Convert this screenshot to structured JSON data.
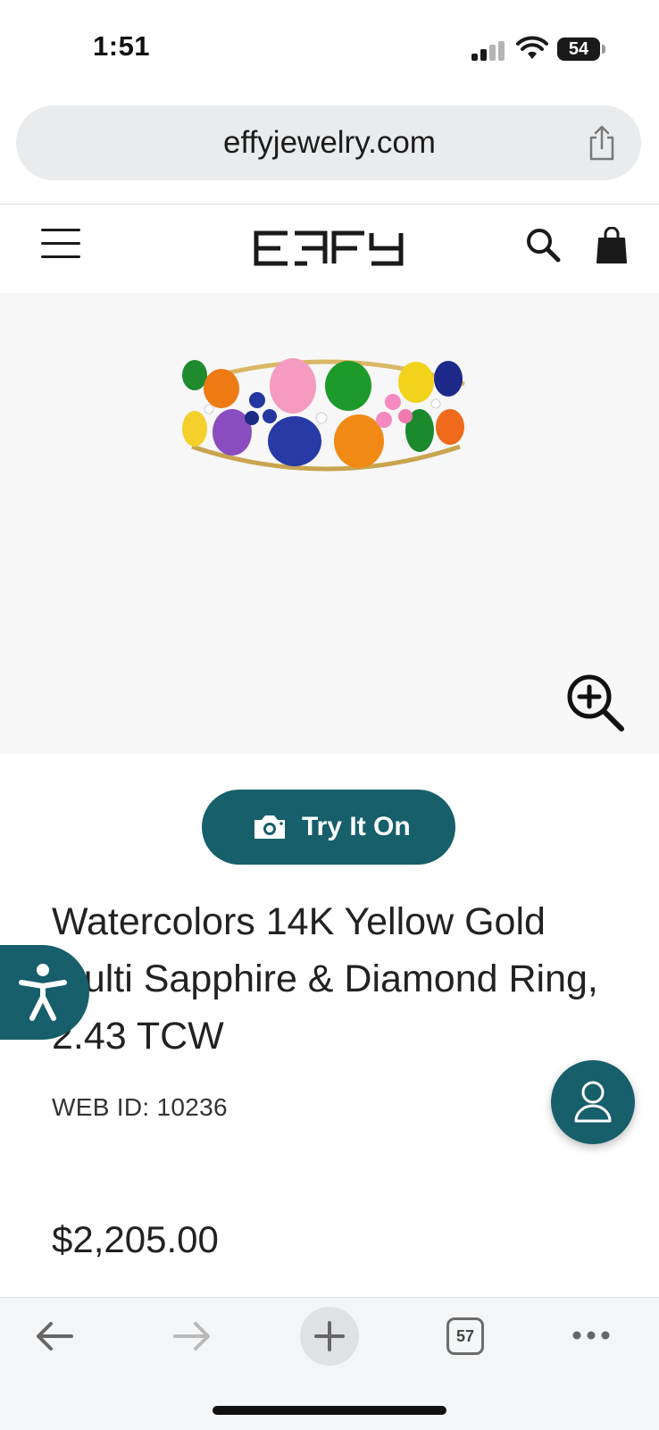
{
  "status_bar": {
    "time": "1:51",
    "battery": "54"
  },
  "browser": {
    "url": "effyjewelry.com",
    "tab_count": "57"
  },
  "header": {
    "logo_text": "EFFY"
  },
  "product": {
    "try_on_label": "Try It On",
    "title": "Watercolors 14K Yellow Gold Multi Sapphire & Diamond Ring, 2.43 TCW",
    "web_id_label": "WEB ID:",
    "web_id": "10236",
    "price": "$2,205.00"
  },
  "colors": {
    "brand_teal": "#165f6b"
  },
  "icons": [
    "signal-icon",
    "wifi-icon",
    "battery-icon",
    "share-icon",
    "menu-icon",
    "search-icon",
    "shopping-bag-icon",
    "zoom-in-icon",
    "camera-icon",
    "accessibility-icon",
    "account-icon",
    "back-arrow-icon",
    "forward-arrow-icon",
    "plus-icon",
    "tabs-icon",
    "more-icon"
  ]
}
